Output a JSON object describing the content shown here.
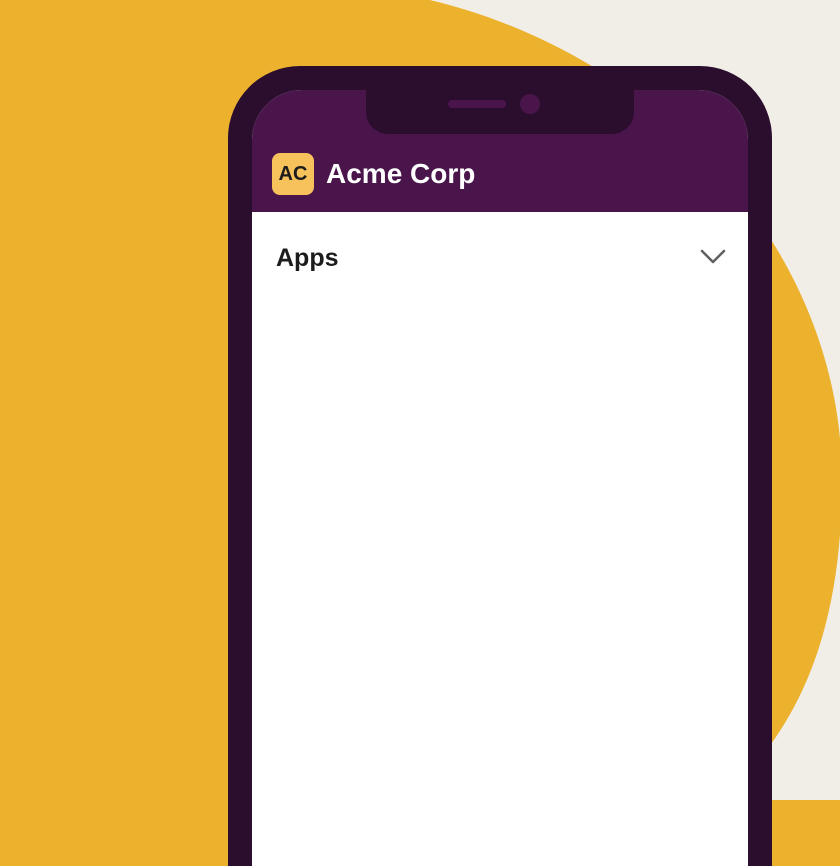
{
  "colors": {
    "background_accent": "#ECB22E",
    "background_secondary": "#F1EEE7",
    "phone_frame": "#2B0D2E",
    "header": "#4A154B",
    "avatar": "#F7C15C",
    "screen": "#FFFFFF",
    "text": "#1D1C1D"
  },
  "workspace": {
    "avatar_text": "AC",
    "name": "Acme Corp"
  },
  "sidebar": {
    "section_label": "Apps",
    "section_icon": "chevron-down-icon"
  }
}
